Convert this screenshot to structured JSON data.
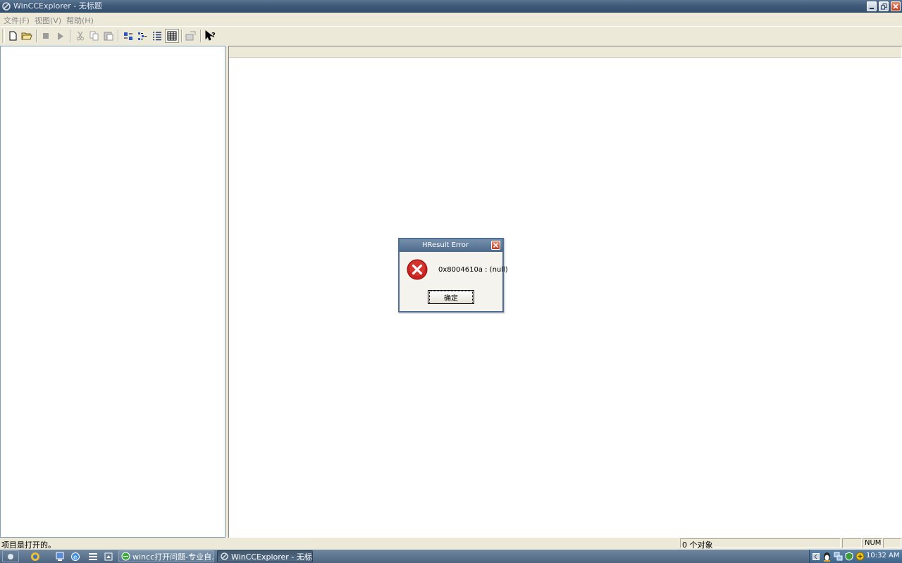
{
  "window": {
    "title": "WinCCExplorer - 无标题"
  },
  "menu": {
    "items": [
      {
        "label": "文件(F)"
      },
      {
        "label": "视图(V)"
      },
      {
        "label": "帮助(H)"
      }
    ]
  },
  "toolbar": {
    "buttons": [
      "new-file-icon",
      "open-folder-icon",
      "stop-icon",
      "run-icon",
      "cut-icon",
      "copy-icon",
      "paste-icon",
      "large-icons-icon",
      "small-icons-icon",
      "list-view-icon",
      "details-view-icon",
      "properties-icon",
      "help-icon"
    ]
  },
  "dialog": {
    "title": "HResult Error",
    "message": "0x8004610a : (null)",
    "ok_label": "确定",
    "icon": "error-icon"
  },
  "statusbar": {
    "text": "项目是打开的。",
    "object_count": "0 个对象",
    "num_indicator": "NUM"
  },
  "taskbar": {
    "tasks": [
      {
        "label": "wincc打开问题-专业自..."
      },
      {
        "label": "WinCCExplorer - 无标题"
      }
    ],
    "clock": "10:32 AM"
  },
  "colors": {
    "titlebar": "#3e5a78",
    "error_red": "#c9211e",
    "taskbar": "#4d6580"
  }
}
